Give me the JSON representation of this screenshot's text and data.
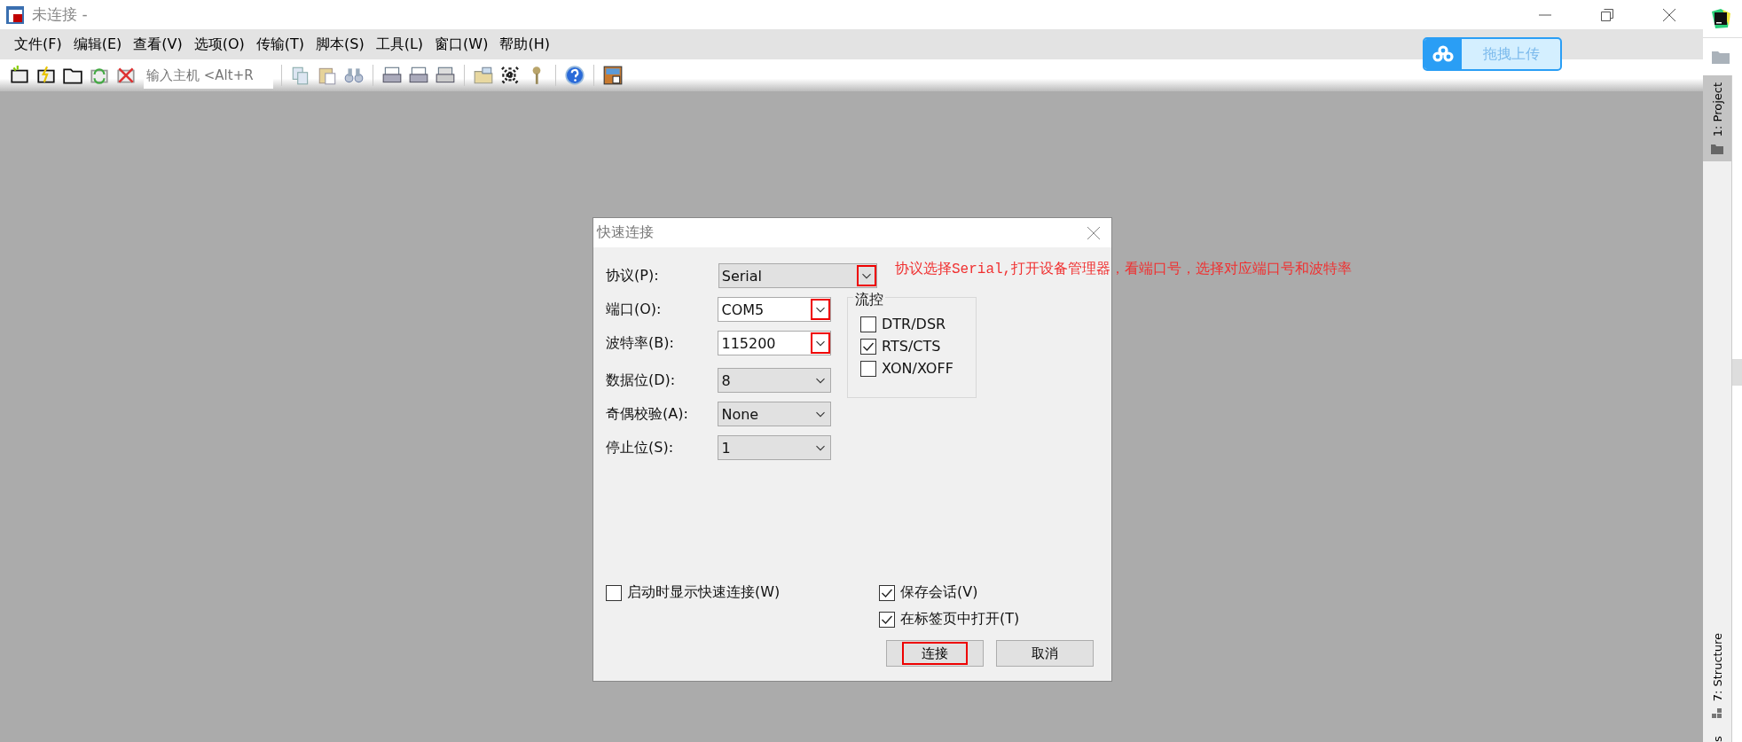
{
  "window": {
    "title": "未连接 -"
  },
  "menu": [
    "文件(F)",
    "编辑(E)",
    "查看(V)",
    "选项(O)",
    "传输(T)",
    "脚本(S)",
    "工具(L)",
    "窗口(W)",
    "帮助(H)"
  ],
  "toolbar": {
    "host_field": {
      "placeholder": "输入主机 <Alt+R"
    }
  },
  "upload_button": {
    "label": "拖拽上传"
  },
  "dialog": {
    "title": "快速连接",
    "fields": [
      {
        "label": "协议(P):",
        "value": "Serial",
        "kind": "dropdown",
        "marked": true
      },
      {
        "label": "端口(O):",
        "value": "COM5",
        "kind": "editable",
        "marked": true
      },
      {
        "label": "波特率(B):",
        "value": "115200",
        "kind": "editable",
        "marked": true
      },
      {
        "label": "数据位(D):",
        "value": "8",
        "kind": "dropdown",
        "marked": false
      },
      {
        "label": "奇偶校验(A):",
        "value": "None",
        "kind": "dropdown",
        "marked": false
      },
      {
        "label": "停止位(S):",
        "value": "1",
        "kind": "dropdown",
        "marked": false
      }
    ],
    "flow_control": {
      "title": "流控",
      "options": [
        {
          "label": "DTR/DSR",
          "checked": false
        },
        {
          "label": "RTS/CTS",
          "checked": true
        },
        {
          "label": "XON/XOFF",
          "checked": false
        }
      ]
    },
    "startup_option": {
      "label": "启动时显示快速连接(W)",
      "checked": false
    },
    "options": [
      {
        "label": "保存会话(V)",
        "checked": true
      },
      {
        "label": "在标签页中打开(T)",
        "checked": true
      }
    ],
    "buttons": [
      {
        "label": "连接",
        "marked": true
      },
      {
        "label": "取消",
        "marked": false
      }
    ]
  },
  "annotation": "协议选择Serial,打开设备管理器，看端口号，选择对应端口号和波特率",
  "side_panel": {
    "tabs": [
      {
        "label": "1: Project",
        "selected": true
      },
      {
        "label": "7: Structure",
        "selected": false
      }
    ],
    "cut_label": "s"
  }
}
